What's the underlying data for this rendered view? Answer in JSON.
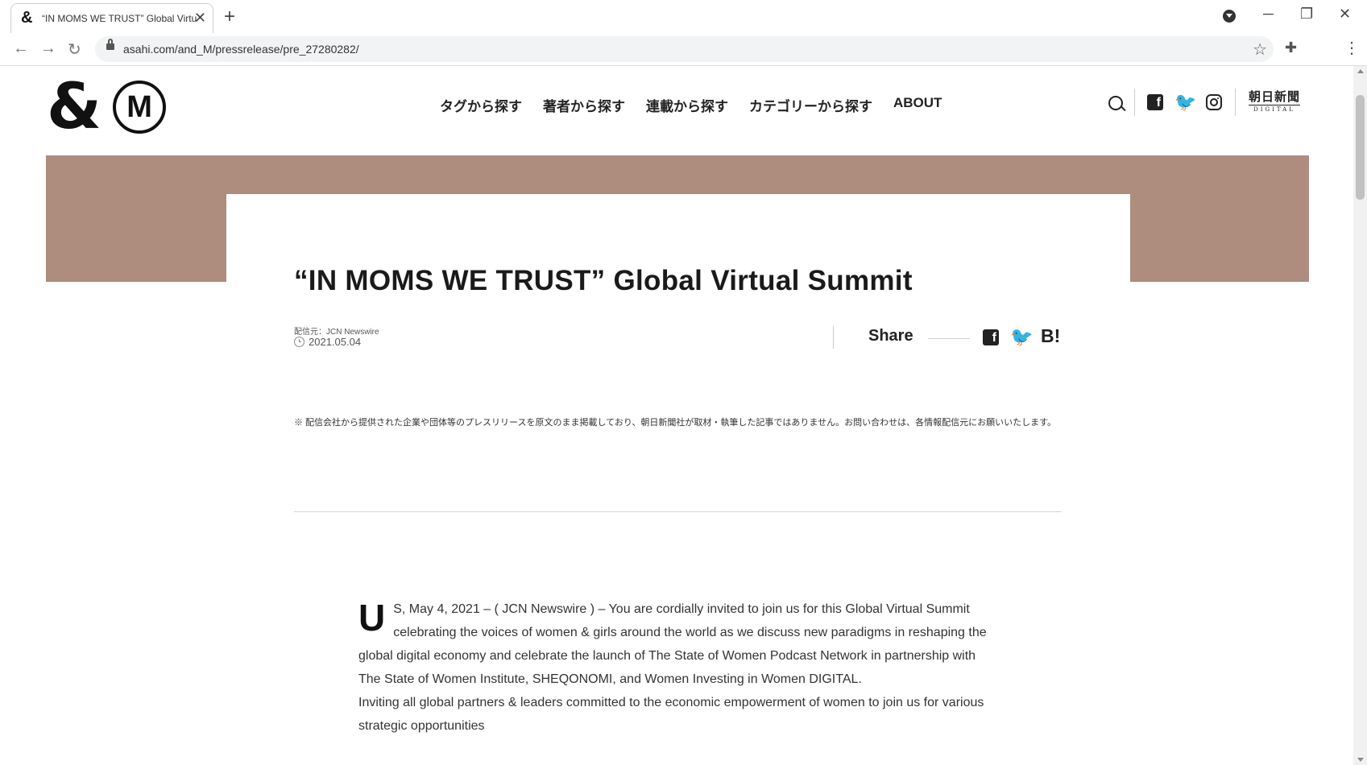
{
  "browser": {
    "tab_title": "“IN MOMS WE TRUST” Global Virtual Summit",
    "tab_favicon": "&",
    "url": "asahi.com/and_M/pressrelease/pre_27280282/"
  },
  "site": {
    "logo_amp": "&",
    "logo_m": "M",
    "nav": [
      "タグから探す",
      "著者から探す",
      "連載から探す",
      "カテゴリーから探す",
      "ABOUT"
    ],
    "asahi_jp": "朝日新聞",
    "asahi_en": "DIGITAL"
  },
  "article": {
    "title": "“IN MOMS WE TRUST” Global Virtual Summit",
    "source": "配信元：JCN Newswire",
    "date": "2021.05.04",
    "share_label": "Share",
    "hatena_label": "B!",
    "disclaimer": "※ 配信会社から提供された企業や団体等のプレスリリースを原文のまま掲載しており、朝日新聞社が取材・執筆した記事ではありません。お問い合わせは、各情報配信元にお願いいたします。",
    "dropcap": "U",
    "paragraph1": "S, May 4, 2021 – ( JCN Newswire ) – You are cordially invited to join us for this Global Virtual Summit celebrating the voices of women & girls around the world as we discuss new paradigms in reshaping the global digital economy and celebrate the launch of The State of Women Podcast Network in partnership with The State of Women Institute, SHEQONOMI, and Women Investing in Women DIGITAL.",
    "paragraph2": "Inviting all global partners & leaders committed to the economic empowerment of women to join us for various strategic opportunities"
  },
  "colors": {
    "hero_band": "#ae8c7e"
  }
}
